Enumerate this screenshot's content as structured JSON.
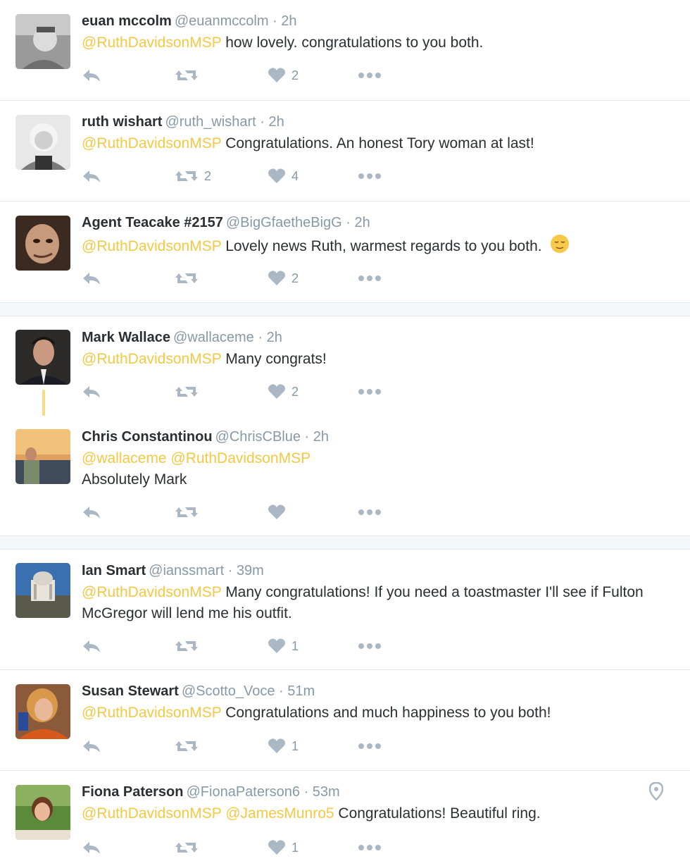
{
  "tweets": [
    {
      "name": "euan mccolm",
      "handle": "@euanmccolm",
      "time": "2h",
      "parts": [
        {
          "t": "@RuthDavidsonMSP",
          "m": true
        },
        {
          "t": " how lovely. congratulations to you both.",
          "m": false
        }
      ],
      "retweets": "",
      "likes": "2"
    },
    {
      "name": "ruth wishart",
      "handle": "@ruth_wishart",
      "time": "2h",
      "parts": [
        {
          "t": "@RuthDavidsonMSP",
          "m": true
        },
        {
          "t": " Congratulations.  An honest Tory woman at last!",
          "m": false
        }
      ],
      "retweets": "2",
      "likes": "4"
    },
    {
      "name": "Agent Teacake #2157",
      "handle": "@BigGfaetheBigG",
      "time": "2h",
      "parts": [
        {
          "t": "@RuthDavidsonMSP",
          "m": true
        },
        {
          "t": " Lovely news Ruth, warmest regards to you both. ",
          "m": false
        }
      ],
      "emoji": "relieved-face-emoji",
      "retweets": "",
      "likes": "2"
    },
    {
      "name": "Mark Wallace",
      "handle": "@wallaceme",
      "time": "2h",
      "parts": [
        {
          "t": "@RuthDavidsonMSP",
          "m": true
        },
        {
          "t": " Many congrats!",
          "m": false
        }
      ],
      "retweets": "",
      "likes": "2"
    },
    {
      "name": "Chris Constantinou",
      "handle": "@ChrisCBlue",
      "time": "2h",
      "parts": [
        {
          "t": "@wallaceme",
          "m": true
        },
        {
          "t": " ",
          "m": false
        },
        {
          "t": "@RuthDavidsonMSP",
          "m": true
        },
        {
          "t": "\nAbsolutely Mark",
          "m": false
        }
      ],
      "retweets": "",
      "likes": ""
    },
    {
      "name": "Ian Smart",
      "handle": "@ianssmart",
      "time": "39m",
      "parts": [
        {
          "t": "@RuthDavidsonMSP",
          "m": true
        },
        {
          "t": " Many congratulations! If you need a toastmaster I'll see if Fulton McGregor will lend me his outfit.",
          "m": false
        }
      ],
      "retweets": "",
      "likes": "1"
    },
    {
      "name": "Susan Stewart",
      "handle": "@Scotto_Voce",
      "time": "51m",
      "parts": [
        {
          "t": "@RuthDavidsonMSP",
          "m": true
        },
        {
          "t": " Congratulations and much happiness to you both!",
          "m": false
        }
      ],
      "retweets": "",
      "likes": "1"
    },
    {
      "name": "Fiona Paterson",
      "handle": "@FionaPaterson6",
      "time": "53m",
      "parts": [
        {
          "t": "@RuthDavidsonMSP",
          "m": true
        },
        {
          "t": " ",
          "m": false
        },
        {
          "t": "@JamesMunro5",
          "m": true
        },
        {
          "t": " Congratulations! Beautiful ring.",
          "m": false
        }
      ],
      "retweets": "",
      "likes": "1",
      "geo": "map-pin-icon"
    }
  ],
  "separator": " · ",
  "colors": {
    "mention": "#f5c843",
    "muted": "#8899a6",
    "text": "#292f33",
    "thread": "#f6dc8a"
  }
}
